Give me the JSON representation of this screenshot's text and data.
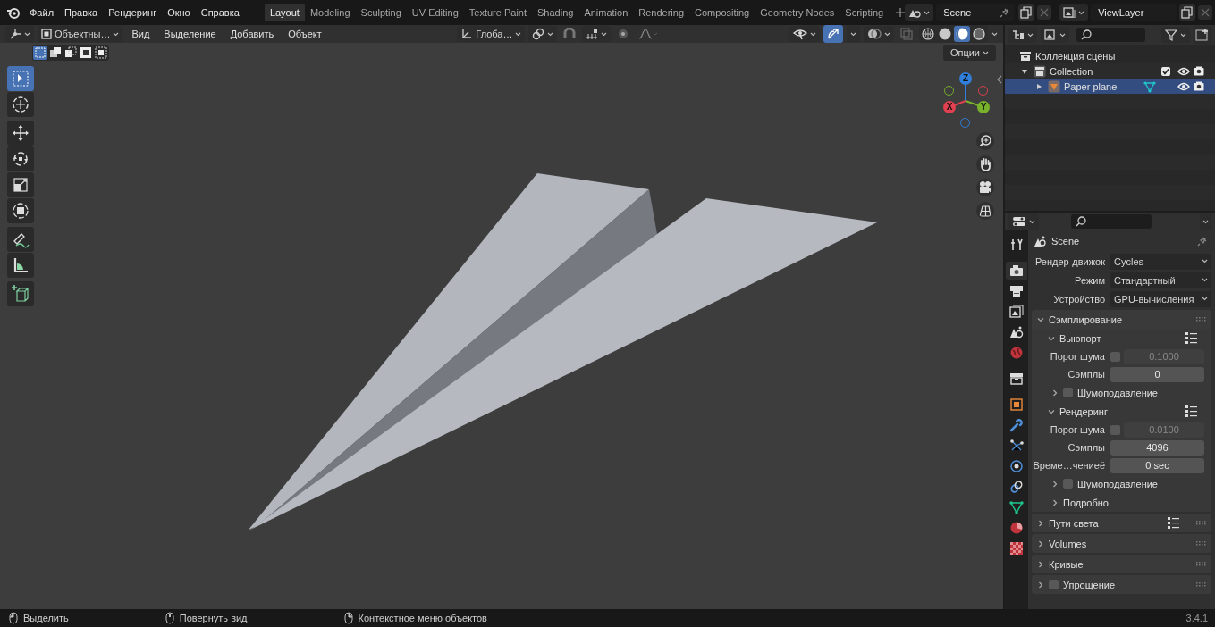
{
  "top_bar": {
    "menu": [
      "Файл",
      "Правка",
      "Рендеринг",
      "Окно",
      "Справка"
    ],
    "workspaces": [
      {
        "label": "Layout",
        "selected": true
      },
      {
        "label": "Modeling",
        "selected": false
      },
      {
        "label": "Sculpting",
        "selected": false
      },
      {
        "label": "UV Editing",
        "selected": false
      },
      {
        "label": "Texture Paint",
        "selected": false
      },
      {
        "label": "Shading",
        "selected": false
      },
      {
        "label": "Animation",
        "selected": false
      },
      {
        "label": "Rendering",
        "selected": false
      },
      {
        "label": "Compositing",
        "selected": false
      },
      {
        "label": "Geometry Nodes",
        "selected": false
      },
      {
        "label": "Scripting",
        "selected": false
      }
    ],
    "scene": "Scene",
    "view_layer": "ViewLayer"
  },
  "viewport": {
    "gizmos_on": true,
    "mode": "Объектны…",
    "menus": [
      "Вид",
      "Выделение",
      "Добавить",
      "Объект"
    ],
    "orientation": "Глоба…",
    "options": "Опции",
    "select_modes": [
      {
        "kind": "set",
        "selected": true
      },
      {
        "kind": "extend",
        "selected": false
      },
      {
        "kind": "subtract",
        "selected": false
      },
      {
        "kind": "difference",
        "selected": false
      },
      {
        "kind": "intersect",
        "selected": false
      }
    ],
    "shading": [
      {
        "kind": "wireframe",
        "selected": false
      },
      {
        "kind": "solid",
        "selected": false
      },
      {
        "kind": "material",
        "selected": true
      },
      {
        "kind": "rendered",
        "selected": false
      }
    ],
    "tool_groups": [
      [
        {
          "kind": "select",
          "selected": true
        },
        {
          "kind": "cursor",
          "selected": false
        }
      ],
      [
        {
          "kind": "move",
          "selected": false
        },
        {
          "kind": "rotate",
          "selected": false
        },
        {
          "kind": "scale",
          "selected": false
        },
        {
          "kind": "transform",
          "selected": false
        }
      ],
      [
        {
          "kind": "annotate",
          "selected": false
        },
        {
          "kind": "measure",
          "selected": false
        }
      ],
      [
        {
          "kind": "add-cube",
          "selected": false
        }
      ]
    ],
    "gizmo": [
      {
        "label": "Z",
        "color": "#2f7fdb"
      },
      {
        "label": "X",
        "color": "#e0404f"
      },
      {
        "label": "Y",
        "color": "#77b22a"
      }
    ]
  },
  "outliner": {
    "title": "Коллекция сцены",
    "items": [
      {
        "label": "Collection",
        "kind": "collection",
        "expanded": true,
        "checked": true,
        "selected": false,
        "children": [
          {
            "label": "Paper plane",
            "kind": "object",
            "expanded": false,
            "selected": true
          }
        ]
      }
    ]
  },
  "properties": {
    "tabs": [
      {
        "kind": "tool",
        "selected": false
      },
      {
        "kind": "render",
        "selected": true
      },
      {
        "kind": "output",
        "selected": false
      },
      {
        "kind": "view-layer",
        "selected": false
      },
      {
        "kind": "scene",
        "selected": false
      },
      {
        "kind": "world",
        "selected": false
      },
      {
        "kind": "collection",
        "selected": false
      },
      {
        "kind": "object",
        "selected": false
      },
      {
        "kind": "modifier",
        "selected": false
      },
      {
        "kind": "particles",
        "selected": false
      },
      {
        "kind": "physics",
        "selected": false
      },
      {
        "kind": "constraints",
        "selected": false
      },
      {
        "kind": "data",
        "selected": false
      },
      {
        "kind": "material",
        "selected": false
      },
      {
        "kind": "texture",
        "selected": false
      }
    ],
    "context": "Scene",
    "fields": [
      {
        "label": "Рендер-движок",
        "value": "Cycles"
      },
      {
        "label": "Режим",
        "value": "Стандартный"
      },
      {
        "label": "Устройство",
        "value": "GPU-вычисления"
      }
    ],
    "panels": [
      {
        "title": "Сэмплирование",
        "expanded": true,
        "presets": false,
        "children": [
          {
            "title": "Выюпорт",
            "expanded": true,
            "presets": true,
            "rows": [
              {
                "kind": "toggle-number",
                "label": "Порог шума",
                "checked": false,
                "value": "0.1000"
              },
              {
                "kind": "number",
                "label": "Сэмплы",
                "value": "0"
              }
            ],
            "children": [
              {
                "title": "Шумоподавление",
                "expanded": false,
                "checked": false
              }
            ]
          },
          {
            "title": "Рендеринг",
            "expanded": true,
            "presets": true,
            "rows": [
              {
                "kind": "toggle-number",
                "label": "Порог шума",
                "checked": false,
                "value": "0.0100"
              },
              {
                "kind": "number",
                "label": "Сэмплы",
                "value": "4096"
              },
              {
                "kind": "number",
                "label": "Време…чениеё",
                "value": "0 sec"
              }
            ],
            "children": [
              {
                "title": "Шумоподавление",
                "expanded": false,
                "checked": false
              },
              {
                "title": "Подробно",
                "expanded": false
              }
            ]
          }
        ]
      },
      {
        "title": "Пути света",
        "expanded": false,
        "presets": true
      },
      {
        "title": "Volumes",
        "expanded": false,
        "presets": false
      },
      {
        "title": "Кривые",
        "expanded": false,
        "presets": false
      },
      {
        "title": "Упрощение",
        "expanded": false,
        "presets": false,
        "checked": false
      }
    ]
  },
  "status_bar": {
    "hints": [
      "Выделить",
      "Повернуть вид",
      "Контекстное меню объектов"
    ],
    "version": "3.4.1"
  }
}
